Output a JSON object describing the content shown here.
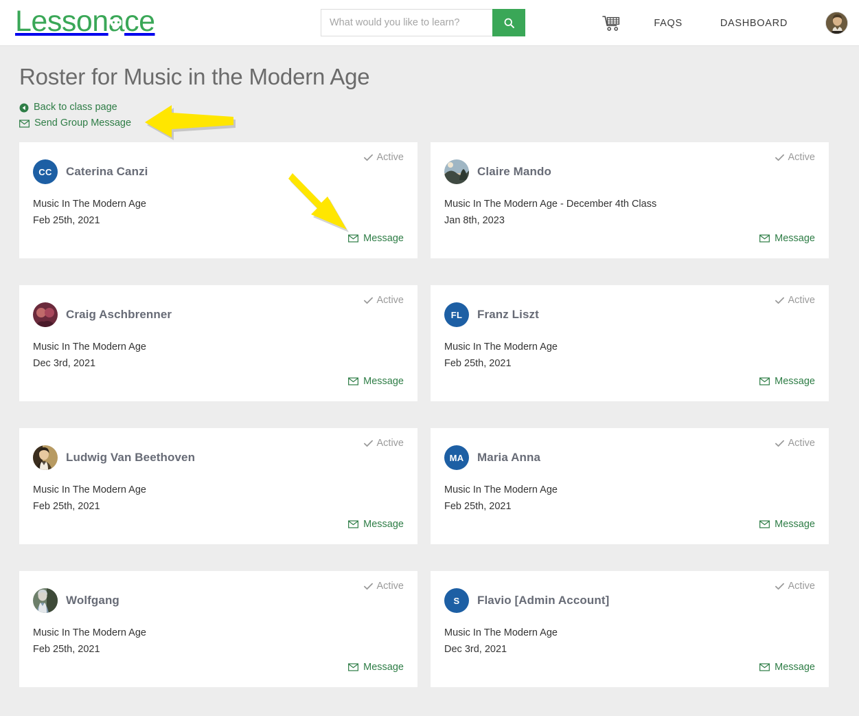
{
  "header": {
    "brand": {
      "before": "Lesson",
      "face_letter": "a",
      "after": "ce"
    },
    "search": {
      "placeholder": "What would you like to learn?",
      "value": "",
      "icon": "search-icon",
      "button_color": "#3aa757"
    },
    "cart_icon": "shopping-cart-icon",
    "nav": [
      {
        "label": "FAQS",
        "name": "nav-faqs"
      },
      {
        "label": "DASHBOARD",
        "name": "nav-dashboard"
      }
    ],
    "avatar_alt": "user-profile-photo"
  },
  "page": {
    "title": "Roster for Music in the Modern Age",
    "links": [
      {
        "label": "Back to class page",
        "icon": "back-arrow-circle-icon",
        "name": "back-to-class-page-link"
      },
      {
        "label": "Send Group Message",
        "icon": "envelope-icon",
        "name": "send-group-message-link"
      }
    ],
    "status_label": "Active",
    "message_label": "Message",
    "accent_green": "#2e7d46",
    "avatar_blue": "#1d5fa4",
    "annotation_color": "#ffe600"
  },
  "roster": [
    {
      "name": "Caterina Canzi",
      "avatar_type": "initials",
      "initials": "CC",
      "class": "Music In The Modern Age",
      "date": "Feb 25th, 2021",
      "status": "Active",
      "message": "Message"
    },
    {
      "name": "Claire Mando",
      "avatar_type": "photo",
      "initials": "",
      "class": "Music In The Modern Age - December 4th Class",
      "date": "Jan 8th, 2023",
      "status": "Active",
      "message": "Message"
    },
    {
      "name": "Craig Aschbrenner",
      "avatar_type": "photo",
      "initials": "",
      "class": "Music In The Modern Age",
      "date": "Dec 3rd, 2021",
      "status": "Active",
      "message": "Message"
    },
    {
      "name": "Franz Liszt",
      "avatar_type": "initials",
      "initials": "FL",
      "class": "Music In The Modern Age",
      "date": "Feb 25th, 2021",
      "status": "Active",
      "message": "Message"
    },
    {
      "name": "Ludwig Van Beethoven",
      "avatar_type": "photo",
      "initials": "",
      "class": "Music In The Modern Age",
      "date": "Feb 25th, 2021",
      "status": "Active",
      "message": "Message"
    },
    {
      "name": "Maria Anna",
      "avatar_type": "initials",
      "initials": "MA",
      "class": "Music In The Modern Age",
      "date": "Feb 25th, 2021",
      "status": "Active",
      "message": "Message"
    },
    {
      "name": "Wolfgang",
      "avatar_type": "photo",
      "initials": "",
      "class": "Music In The Modern Age",
      "date": "Feb 25th, 2021",
      "status": "Active",
      "message": "Message"
    },
    {
      "name": "Flavio [Admin Account]",
      "avatar_type": "initials",
      "initials": "S",
      "class": "Music In The Modern Age",
      "date": "Dec 3rd, 2021",
      "status": "Active",
      "message": "Message"
    }
  ]
}
